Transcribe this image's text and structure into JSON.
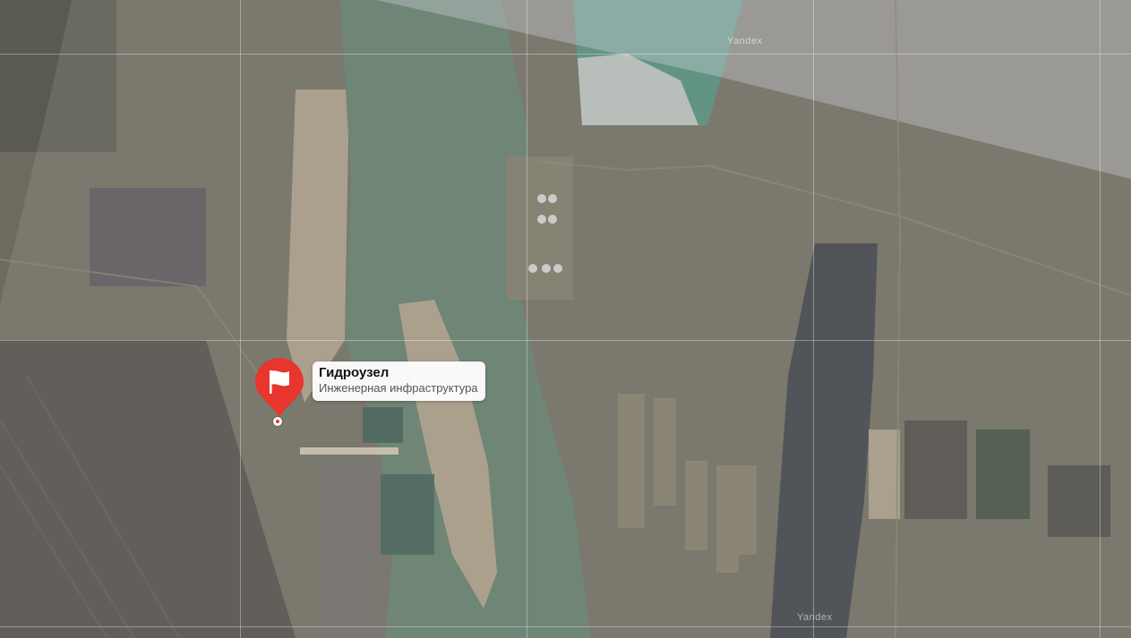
{
  "map": {
    "provider_watermarks": [
      "Yandex",
      "Yandex"
    ]
  },
  "marker": {
    "title": "Гидроузел",
    "subtitle": "Инженерная инфраструктура",
    "icon": "flag-icon",
    "color": "#e8352d"
  }
}
